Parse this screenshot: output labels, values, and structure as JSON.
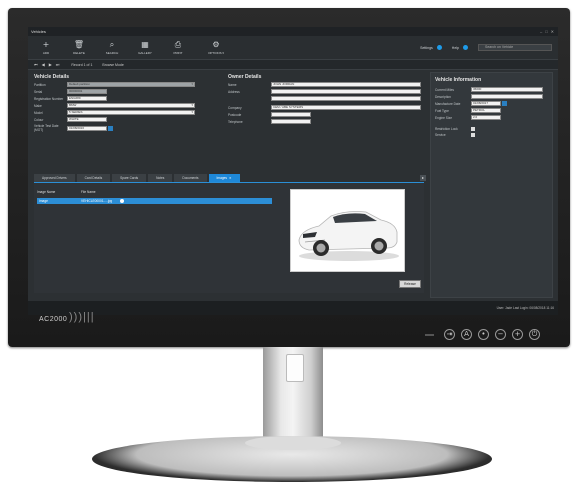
{
  "app": {
    "window_title": "Vehicles",
    "window_controls": [
      "–",
      "□",
      "✕"
    ]
  },
  "toolbar": {
    "buttons": [
      {
        "icon": "plus-icon",
        "label": "ADD"
      },
      {
        "icon": "trash-icon",
        "label": "DELETE"
      },
      {
        "icon": "search-icon",
        "label": "SEARCH"
      },
      {
        "icon": "gallery-icon",
        "label": "GALLERY"
      },
      {
        "icon": "print-icon",
        "label": "PRINT"
      },
      {
        "icon": "gear-icon",
        "label": "OPTIONS ▾"
      }
    ],
    "settings_label": "Settings",
    "help_label": "Help",
    "search_placeholder": "Search on Vehicle"
  },
  "navbar": {
    "record": "Record 1 of 1",
    "mode": "Browse Mode"
  },
  "vehicle_details": {
    "title": "Vehicle Details",
    "fields": [
      {
        "label": "Partition",
        "value": "Default partition"
      },
      {
        "label": "Serial",
        "value": "00000001"
      },
      {
        "label": "Registration Number",
        "value": "ENG689"
      },
      {
        "label": "Make",
        "value": "BMW"
      },
      {
        "label": "Model",
        "value": "5 SERIES"
      },
      {
        "label": "Colour",
        "value": "WHITE"
      },
      {
        "label": "Vehicle Test Date (MOT)",
        "value": "01/08/2016"
      }
    ]
  },
  "owner_details": {
    "title": "Owner Details",
    "fields": [
      {
        "label": "Name",
        "value": "JOHN JORDAN"
      },
      {
        "label": "Address",
        "value": ""
      },
      {
        "label": "",
        "value": ""
      },
      {
        "label": "Company",
        "value": "CEM / ABE SYSTEMS"
      },
      {
        "label": "Postcode",
        "value": ""
      },
      {
        "label": "Telephone",
        "value": ""
      }
    ]
  },
  "vehicle_information": {
    "title": "Vehicle Information",
    "fields": [
      {
        "label": "Current Miles",
        "value": "36000"
      },
      {
        "label": "Description",
        "value": ""
      },
      {
        "label": "Manufacture Date",
        "value": "01/08/2017"
      },
      {
        "label": "Fuel Type",
        "value": "PETROL"
      },
      {
        "label": "Engine Size",
        "value": "2.0"
      }
    ],
    "checks": [
      {
        "label": "Restriction Lock"
      },
      {
        "label": "Service"
      }
    ]
  },
  "tabs": [
    {
      "label": "Approved Drivers",
      "active": false
    },
    {
      "label": "Card Details",
      "active": false
    },
    {
      "label": "Spare Cards",
      "active": false
    },
    {
      "label": "Notes",
      "active": false
    },
    {
      "label": "Documents",
      "active": false
    },
    {
      "label": "Images",
      "active": true
    }
  ],
  "images_grid": {
    "columns": [
      "Image Name",
      "File Name"
    ],
    "rows": [
      {
        "name": "Image",
        "file": "VEHICLE00001.....jpg"
      }
    ]
  },
  "release_label": "Release",
  "status_bar": {
    "text": "User: Jade  Last Login: 06/08/2018 11:16"
  },
  "monitor": {
    "brand": "AC2000",
    "brand_bars": ")))|||"
  }
}
